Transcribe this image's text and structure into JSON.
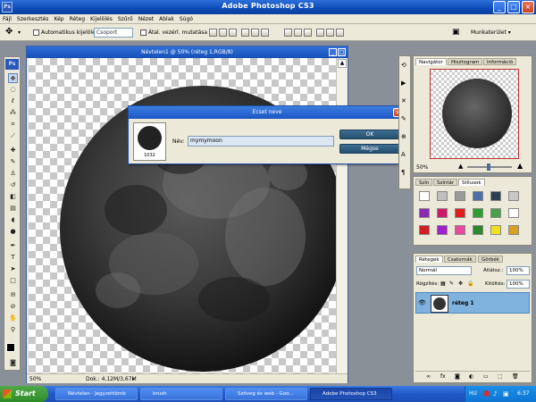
{
  "app": {
    "title": "Adobe Photoshop CS3",
    "logo": "Ps"
  },
  "menu": [
    "Fájl",
    "Szerkesztés",
    "Kép",
    "Réteg",
    "Kijelölés",
    "Szűrő",
    "Nézet",
    "Ablak",
    "Súgó"
  ],
  "options": {
    "auto_select_label": "Automatikus kijelölés:",
    "auto_select_value": "Csoport",
    "transform_label": "Átal. vezérl. mutatása",
    "workspace_label": "Munkaterület"
  },
  "document": {
    "title": "Névtelen1 @ 50% (réteg 1,RGB/8)",
    "zoom": "50%",
    "doc_info": "Dok.: 4,12M/3,67M"
  },
  "dialog": {
    "title": "Ecset neve",
    "brush_size": "1032",
    "name_label": "Név:",
    "name_value": "mymymoon",
    "ok_label": "OK",
    "cancel_label": "Mégse"
  },
  "navigator": {
    "tabs": [
      "Navigátor",
      "Hisztogram",
      "Információ"
    ],
    "zoom": "50%"
  },
  "styles": {
    "tabs": [
      "Szín",
      "Színtár",
      "Stílusok"
    ],
    "colors": [
      "#ffffff",
      "#c0c0c0",
      "#9a9a9a",
      "#4d6fa3",
      "#2c3e52",
      "#c8c8c8",
      "#8a2ab0",
      "#d0186a",
      "#e01c1c",
      "#2e9e2e",
      "#4aa14a",
      "#ffffff",
      "#d02020",
      "#a020d0",
      "#e84aa0",
      "#2a8a2a",
      "#f0e020",
      "#d8a020"
    ]
  },
  "layers": {
    "tabs": [
      "Rétegek",
      "Csatornák",
      "Görbék"
    ],
    "blend_mode": "Normál",
    "opacity_label": "Átlátsz.:",
    "opacity": "100%",
    "lock_label": "Rögzítés:",
    "fill_label": "Kitöltés:",
    "fill": "100%",
    "layer_name": "réteg 1"
  },
  "taskbar": {
    "start": "Start",
    "items": [
      "Névtelen - Jegyzettömb",
      "brush",
      "Szöveg és web - Goo...",
      "Adobe Photoshop CS3"
    ],
    "lang": "HU",
    "time": "6:37"
  }
}
